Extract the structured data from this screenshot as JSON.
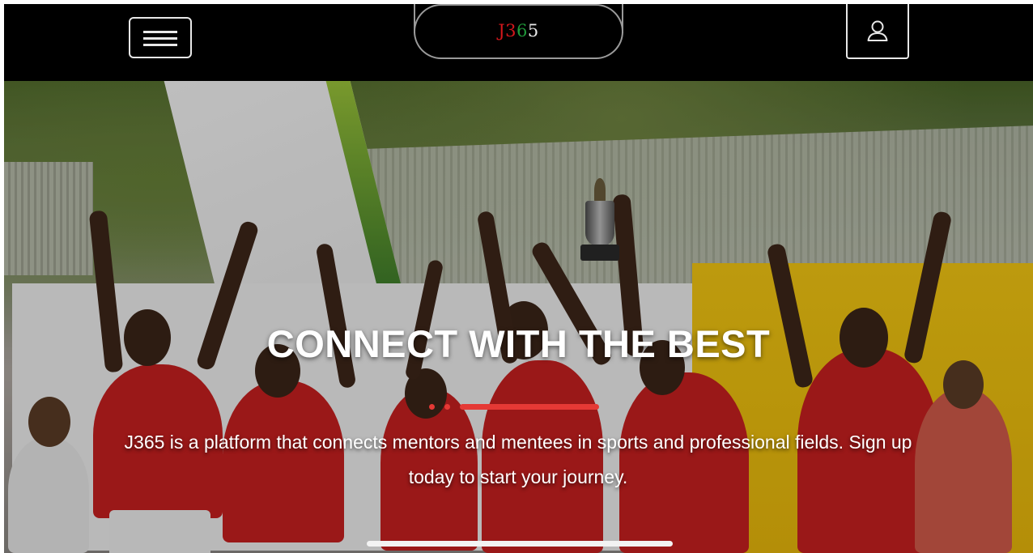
{
  "header": {
    "logo": {
      "j": "J",
      "three": "3",
      "six": "6",
      "five": "5"
    },
    "menu_icon": "hamburger-menu-icon",
    "user_icon": "user-icon"
  },
  "hero": {
    "title": "CONNECT WITH THE BEST",
    "subtitle_line1": "J365  is a platform that connects mentors and mentees in sports and professional fields. Sign up",
    "subtitle_line2": "today to start your journey.",
    "carousel": {
      "total_slides": 3,
      "active_slide": 3
    }
  },
  "colors": {
    "logo_red": "#d4171c",
    "logo_green": "#1f9a3a",
    "accent_indicator": "#e53935"
  }
}
